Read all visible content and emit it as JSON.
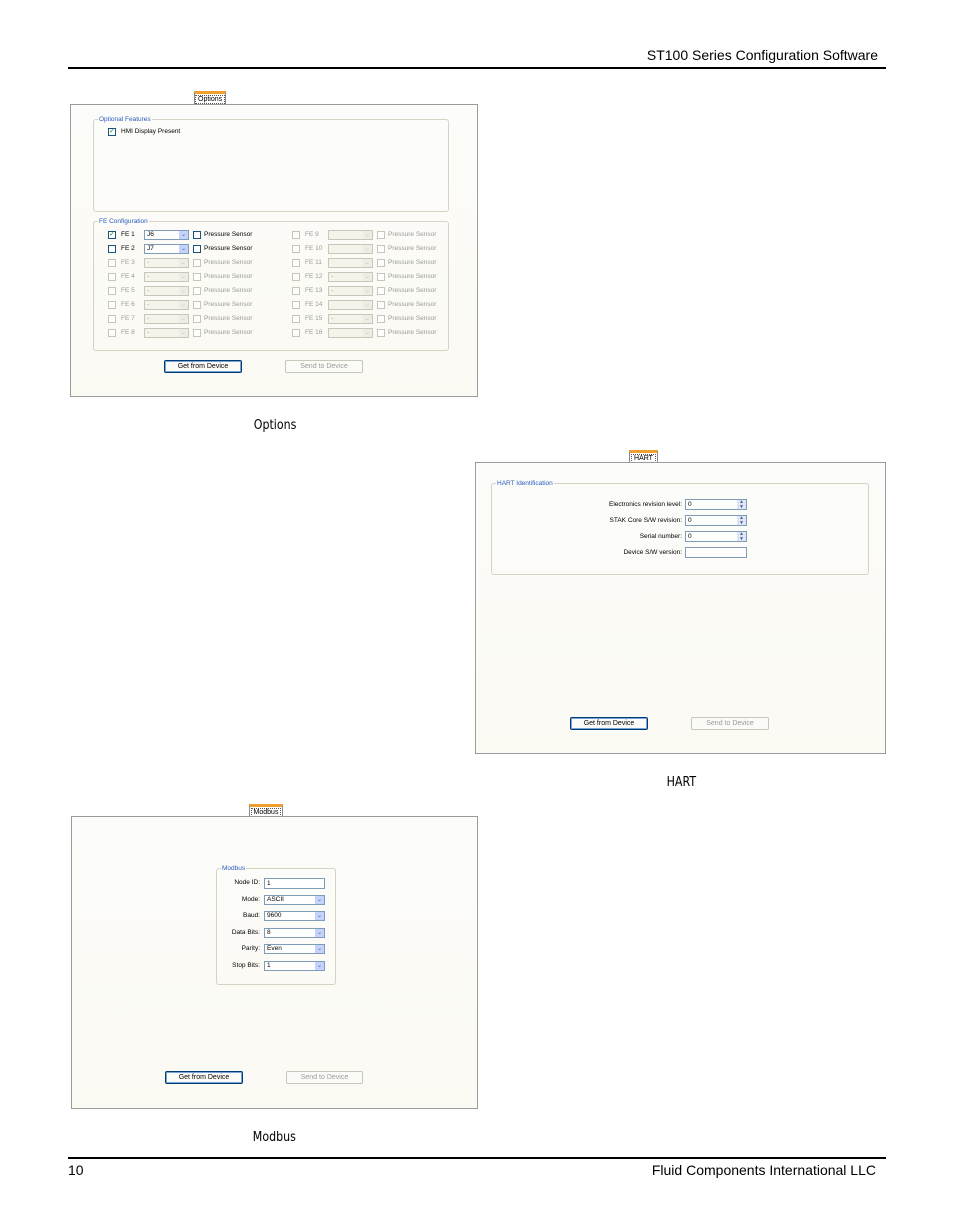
{
  "header": {
    "title": "ST100 Series Configuration Software"
  },
  "footer": {
    "page_number": "10",
    "company": "Fluid Components International LLC"
  },
  "options": {
    "tab": "Options",
    "caption": "Options",
    "optional_features": {
      "legend": "Optional Features",
      "hmi_label": "HMI Display Present",
      "hmi_checked": true
    },
    "fe_config": {
      "legend": "FE Configuration",
      "left": [
        {
          "label": "FE 1",
          "value": "J6",
          "pressure": "Pressure Sensor"
        },
        {
          "label": "FE 2",
          "value": "J7",
          "pressure": "Pressure Sensor"
        },
        {
          "label": "FE 3",
          "value": "-",
          "pressure": "Pressure Sensor"
        },
        {
          "label": "FE 4",
          "value": "-",
          "pressure": "Pressure Sensor"
        },
        {
          "label": "FE 5",
          "value": "-",
          "pressure": "Pressure Sensor"
        },
        {
          "label": "FE 6",
          "value": "-",
          "pressure": "Pressure Sensor"
        },
        {
          "label": "FE 7",
          "value": "-",
          "pressure": "Pressure Sensor"
        },
        {
          "label": "FE 8",
          "value": "-",
          "pressure": "Pressure Sensor"
        }
      ],
      "right": [
        {
          "label": "FE 9",
          "value": "",
          "pressure": "Pressure Sensor"
        },
        {
          "label": "FE 10",
          "value": "",
          "pressure": "Pressure Sensor"
        },
        {
          "label": "FE 11",
          "value": "",
          "pressure": "Pressure Sensor"
        },
        {
          "label": "FE 12",
          "value": "-",
          "pressure": "Pressure Sensor"
        },
        {
          "label": "FE 13",
          "value": "-",
          "pressure": "Pressure Sensor"
        },
        {
          "label": "FE 14",
          "value": "",
          "pressure": "Pressure Sensor"
        },
        {
          "label": "FE 15",
          "value": "-",
          "pressure": "Pressure Sensor"
        },
        {
          "label": "FE 16",
          "value": "",
          "pressure": "Pressure Sensor"
        }
      ]
    },
    "get_button": "Get from Device",
    "send_button": "Send to Device"
  },
  "hart": {
    "tab": "HART",
    "caption": "HART",
    "legend": "HART Identification",
    "fields": [
      {
        "label": "Electronics revision level:",
        "value": "0",
        "spin": true
      },
      {
        "label": "STAK Core S/W revision:",
        "value": "0",
        "spin": true
      },
      {
        "label": "Serial number:",
        "value": "0",
        "spin": true
      },
      {
        "label": "Device S/W version:",
        "value": "",
        "spin": false
      }
    ],
    "get_button": "Get from Device",
    "send_button": "Send to Device"
  },
  "modbus": {
    "tab": "Modbus",
    "caption": "Modbus",
    "legend": "Modbus",
    "fields": [
      {
        "label": "Node ID:",
        "value": "1",
        "type": "text"
      },
      {
        "label": "Mode:",
        "value": "ASCII",
        "type": "combo"
      },
      {
        "label": "Baud:",
        "value": "9600",
        "type": "combo"
      },
      {
        "label": "Data Bits:",
        "value": "8",
        "type": "combo"
      },
      {
        "label": "Parity:",
        "value": "Even",
        "type": "combo"
      },
      {
        "label": "Stop Bits:",
        "value": "1",
        "type": "combo"
      }
    ],
    "get_button": "Get from Device",
    "send_button": "Send to Device"
  }
}
